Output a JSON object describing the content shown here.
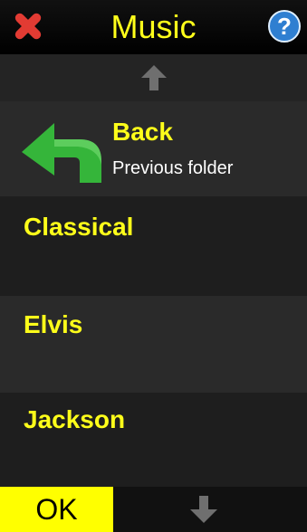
{
  "header": {
    "title": "Music",
    "close_icon": "close-icon",
    "help_icon": "help-icon"
  },
  "list": {
    "items": [
      {
        "label": "Back",
        "subtitle": "Previous folder",
        "icon": "back-arrow-icon"
      },
      {
        "label": "Classical"
      },
      {
        "label": "Elvis"
      },
      {
        "label": "Jackson"
      }
    ]
  },
  "footer": {
    "ok_label": "OK"
  },
  "colors": {
    "accent": "#ffff1a",
    "ok_bg": "#ffff00",
    "back_icon": "#35b53a",
    "close_icon": "#e23b33",
    "help_icon": "#2f7fd1"
  }
}
